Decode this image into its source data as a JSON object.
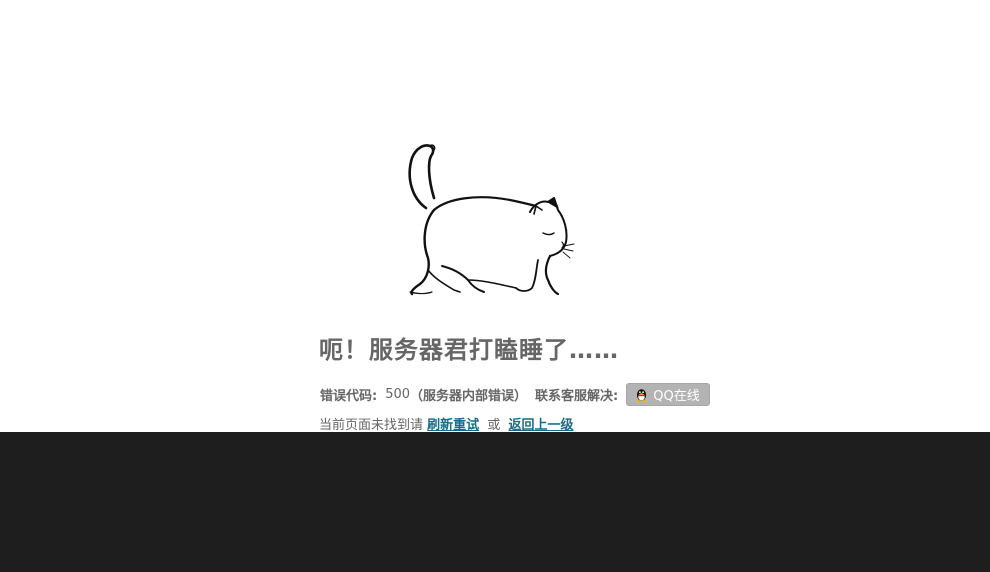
{
  "error": {
    "headline": "呃！服务器君打瞌睡了……",
    "code_label": "错误代码:",
    "code_value": "500",
    "code_desc": "（服务器内部错误）",
    "contact_label": "联系客服解决:",
    "qq_button_label": "QQ在线"
  },
  "help": {
    "prefix": "当前页面未找到请",
    "refresh_link": "刷新重试",
    "or_text": "或",
    "back_link": "返回上一级"
  },
  "icons": {
    "illustration": "walking-cat-illustration",
    "qq": "qq-penguin-icon"
  },
  "colors": {
    "text": "#666666",
    "link": "#1a6b8a",
    "qq_button": "#b3b3b3",
    "footer": "#1e1e1e"
  }
}
